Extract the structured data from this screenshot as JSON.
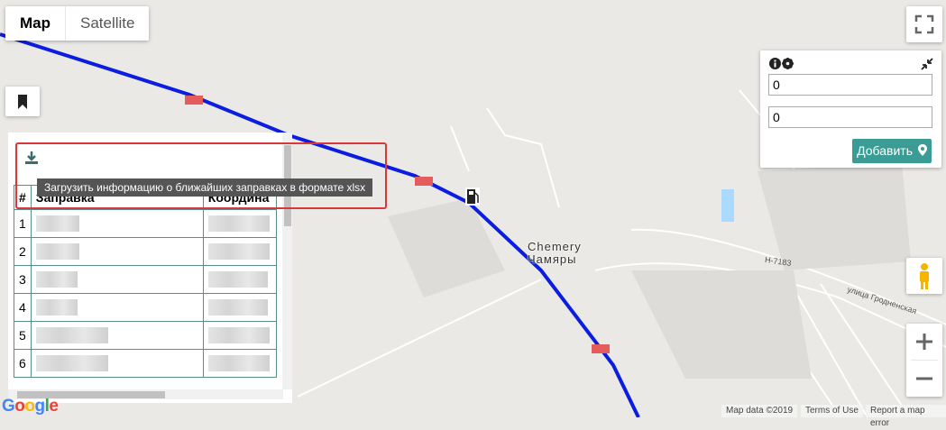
{
  "map_type": {
    "map": "Map",
    "satellite": "Satellite"
  },
  "place": {
    "name_latin": "Chemery",
    "name_cyrillic": "Чамяры"
  },
  "roads": {
    "h7183": "H-7183",
    "grodno_street": "улица Гродненская"
  },
  "route_color": "#0a1de0",
  "panel": {
    "input1_value": "0",
    "input2_value": "0",
    "add_button_label": "Добавить",
    "icons": [
      "info-icon",
      "gear-icon",
      "collapse-icon"
    ]
  },
  "fuel_table": {
    "download_tooltip": "Загрузить информацию о ближайших заправках в формате xlsx",
    "headers": [
      "#",
      "Заправка",
      "Координа"
    ],
    "rows": [
      "1",
      "2",
      "3",
      "4",
      "5",
      "6"
    ]
  },
  "attribution": {
    "map_data": "Map data ©2019",
    "terms": "Terms of Use",
    "report": "Report a map error"
  },
  "logo": "Google"
}
